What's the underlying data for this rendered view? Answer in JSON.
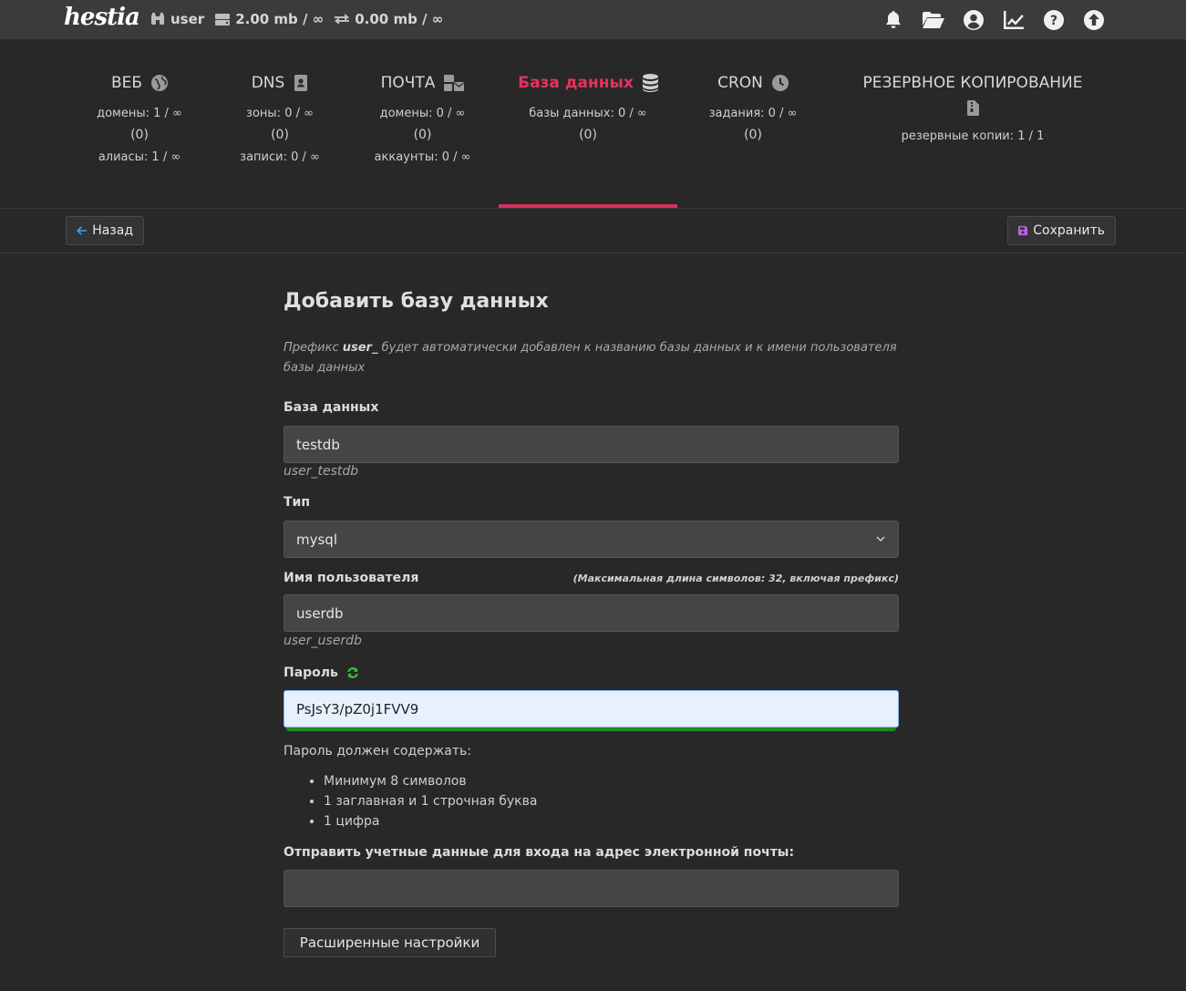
{
  "topbar": {
    "logo": "hestia",
    "user": "user",
    "disk": "2.00 mb / ∞",
    "bandwidth": "0.00 mb / ∞",
    "icons": [
      "bell-icon",
      "folder-open-icon",
      "user-circle-icon",
      "chart-line-icon",
      "help-icon",
      "upload-icon"
    ]
  },
  "tabs": [
    {
      "label": "ВЕБ",
      "icon": "globe-icon",
      "lines": [
        "домены: 1 / ∞",
        "(0)",
        "алиасы: 1 / ∞"
      ]
    },
    {
      "label": "DNS",
      "icon": "address-book-icon",
      "lines": [
        "зоны: 0 / ∞",
        "(0)",
        "записи: 0 / ∞"
      ]
    },
    {
      "label": "ПОЧТА",
      "icon": "mail-bulk-icon",
      "lines": [
        "домены: 0 / ∞",
        "(0)",
        "аккаунты: 0 / ∞"
      ]
    },
    {
      "label": "База данных",
      "icon": "database-icon",
      "lines": [
        "базы данных: 0 / ∞",
        "(0)"
      ]
    },
    {
      "label": "CRON",
      "icon": "clock-icon",
      "lines": [
        "задания: 0 / ∞",
        "(0)"
      ]
    },
    {
      "label": "РЕЗЕРВНОЕ КОПИРОВАНИЕ",
      "icon": "file-archive-icon",
      "lines": [
        "резервные копии: 1 / 1"
      ]
    }
  ],
  "toolbar": {
    "back_label": "Назад",
    "save_label": "Сохранить"
  },
  "form": {
    "title": "Добавить базу данных",
    "hint_prefix": "Префикс ",
    "hint_user": "user_",
    "hint_suffix": " будет автоматически добавлен к названию базы данных и к имени пользователя базы данных",
    "database": {
      "label": "База данных",
      "value": "testdb",
      "hint": "user_testdb"
    },
    "type": {
      "label": "Тип",
      "value": "mysql"
    },
    "username": {
      "label": "Имя пользователя",
      "note": "(Максимальная длина символов: 32, включая префикс)",
      "value": "userdb",
      "hint": "user_userdb"
    },
    "password": {
      "label": "Пароль",
      "value": "PsJsY3/pZ0j1FVV9",
      "strength": 1.0
    },
    "requirements": {
      "title": "Пароль должен содержать:",
      "items": [
        "Минимум 8 символов",
        "1 заглавная и 1 строчная буква",
        "1 цифра"
      ]
    },
    "email": {
      "label": "Отправить учетные данные для входа на адрес электронной почты:",
      "value": ""
    },
    "advanced_label": "Расширенные настройки"
  },
  "colors": {
    "accent": "#d3325e",
    "strength": "#1f8a28",
    "save_icon": "#b564e6",
    "back_icon": "#3fa7f2",
    "refresh_icon": "#35c23a"
  }
}
